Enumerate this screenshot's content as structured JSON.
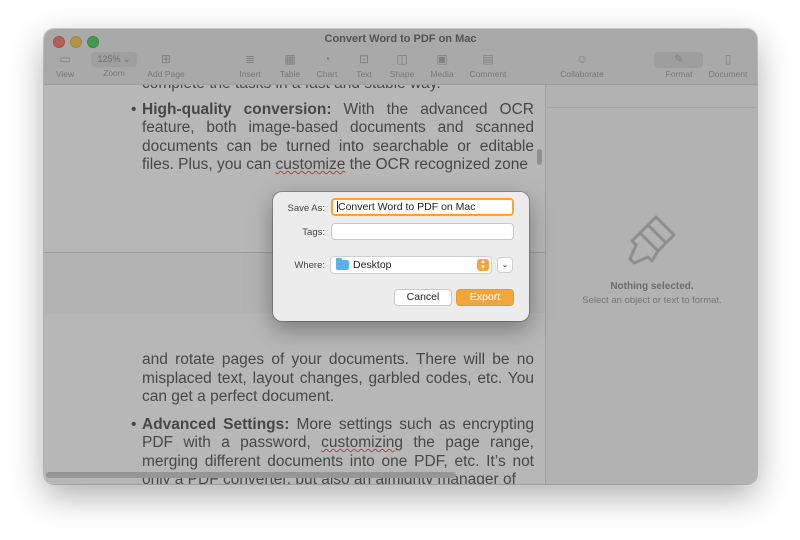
{
  "window": {
    "title": "Convert Word to PDF on Mac"
  },
  "toolbar": {
    "view": "View",
    "zoom_value": "125%",
    "zoom": "Zoom",
    "add_page": "Add Page",
    "insert": "Insert",
    "table": "Table",
    "chart": "Chart",
    "text": "Text",
    "shape": "Shape",
    "media": "Media",
    "comment": "Comment",
    "collaborate": "Collaborate",
    "format": "Format",
    "document": "Document"
  },
  "document": {
    "line0": "complete the tasks in a fast and stable way.",
    "p1_bold": "High-quality conversion:",
    "p1_text_a": " With the advanced OCR feature, both image-based documents and scanned documents can be turned into searchable or editable files. Plus, you can ",
    "p1_squiggle": "customize",
    "p1_text_b": " the OCR recognized zone",
    "p2_text": "and rotate pages of your documents. There will be no misplaced text, layout changes, garbled codes, etc. You can get a perfect document.",
    "p3_bold": "Advanced Settings:",
    "p3_text_a": " More settings such as encrypting PDF with a password, ",
    "p3_squiggle": "customizing",
    "p3_text_b": " the page range, merging different documents into one PDF, etc. It’s not only a PDF converter, but also an almighty manager of"
  },
  "sidebar": {
    "nothing_selected": "Nothing selected.",
    "hint": "Select an object or text to format."
  },
  "dialog": {
    "save_as_label": "Save As:",
    "save_as_value": "Convert Word to PDF on Mac",
    "tags_label": "Tags:",
    "where_label": "Where:",
    "where_value": "Desktop",
    "cancel": "Cancel",
    "export": "Export"
  },
  "colors": {
    "accent": "#f6a53d",
    "close": "#fe5f57",
    "minimize": "#febc2e",
    "maximize": "#28c840"
  }
}
